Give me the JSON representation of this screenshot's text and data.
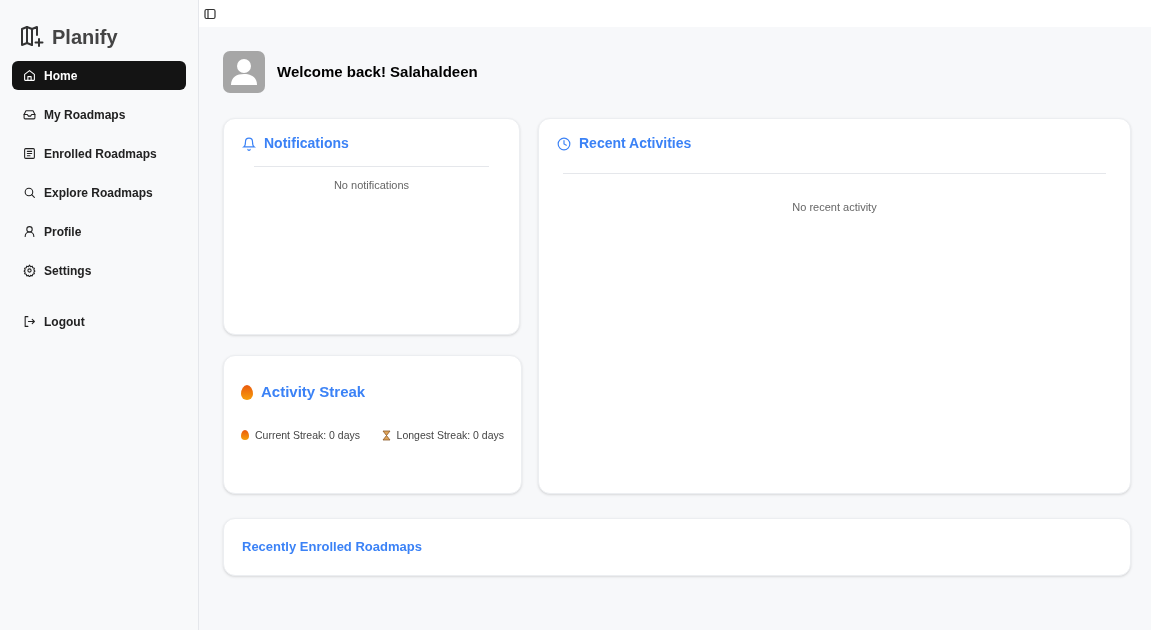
{
  "app": {
    "name": "Planify"
  },
  "sidebar": {
    "items": [
      {
        "label": "Home",
        "selected": true
      },
      {
        "label": "My Roadmaps",
        "selected": false
      },
      {
        "label": "Enrolled Roadmaps",
        "selected": false
      },
      {
        "label": "Explore Roadmaps",
        "selected": false
      },
      {
        "label": "Profile",
        "selected": false
      },
      {
        "label": "Settings",
        "selected": false
      }
    ],
    "logout": "Logout"
  },
  "welcome": "Welcome back! Salahaldeen",
  "notifications": {
    "title": "Notifications",
    "empty": "No notifications"
  },
  "recent_activities": {
    "title": "Recent Activities",
    "empty": "No recent activity"
  },
  "activity_streak": {
    "title": "Activity Streak",
    "current": "Current Streak: 0 days",
    "longest": "Longest Streak: 0 days"
  },
  "recently_enrolled": {
    "title": "Recently Enrolled Roadmaps"
  }
}
